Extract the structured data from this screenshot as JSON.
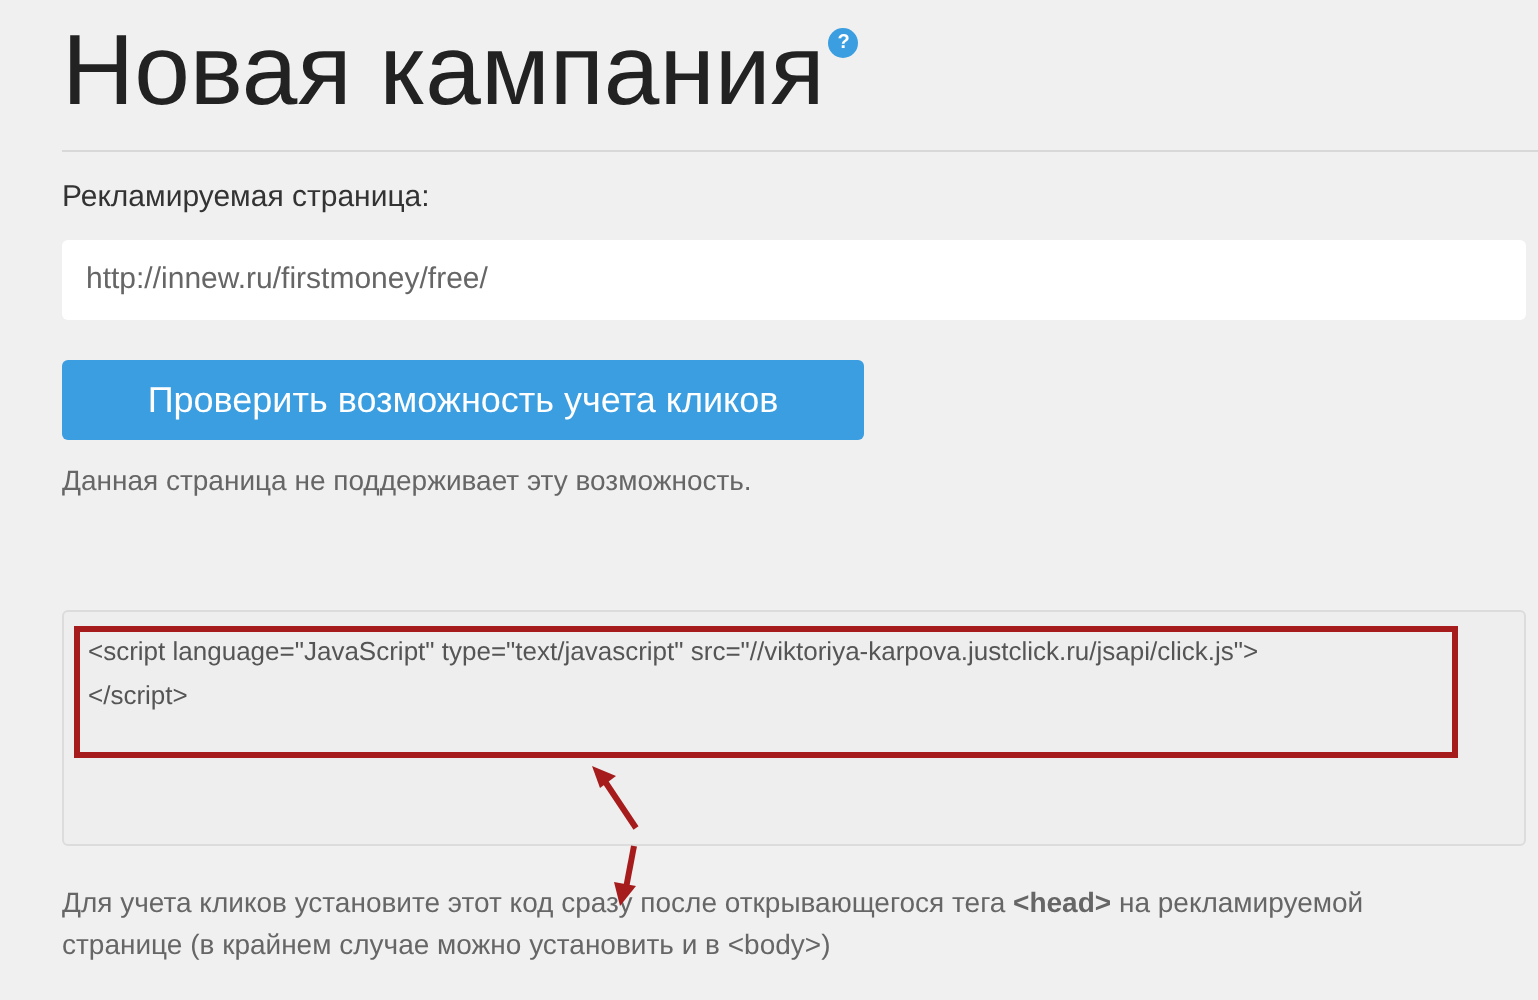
{
  "title": "Новая кампания",
  "help_badge": "?",
  "page_field": {
    "label": "Рекламируемая страница:",
    "value": "http://innew.ru/firstmoney/free/"
  },
  "check_button": "Проверить возможность учета кликов",
  "check_result": "Данная страница не поддерживает эту возможность.",
  "code_box": {
    "value": "<script language=\"JavaScript\" type=\"text/javascript\" src=\"//viktoriya-karpova.justclick.ru/jsapi/click.js\">\n</script>"
  },
  "instructions": "Для учета кликов установите этот код сразу после открывающегося тега **<head>** на рекламируемой странице (в крайнем случае можно установить и в <body>)"
}
